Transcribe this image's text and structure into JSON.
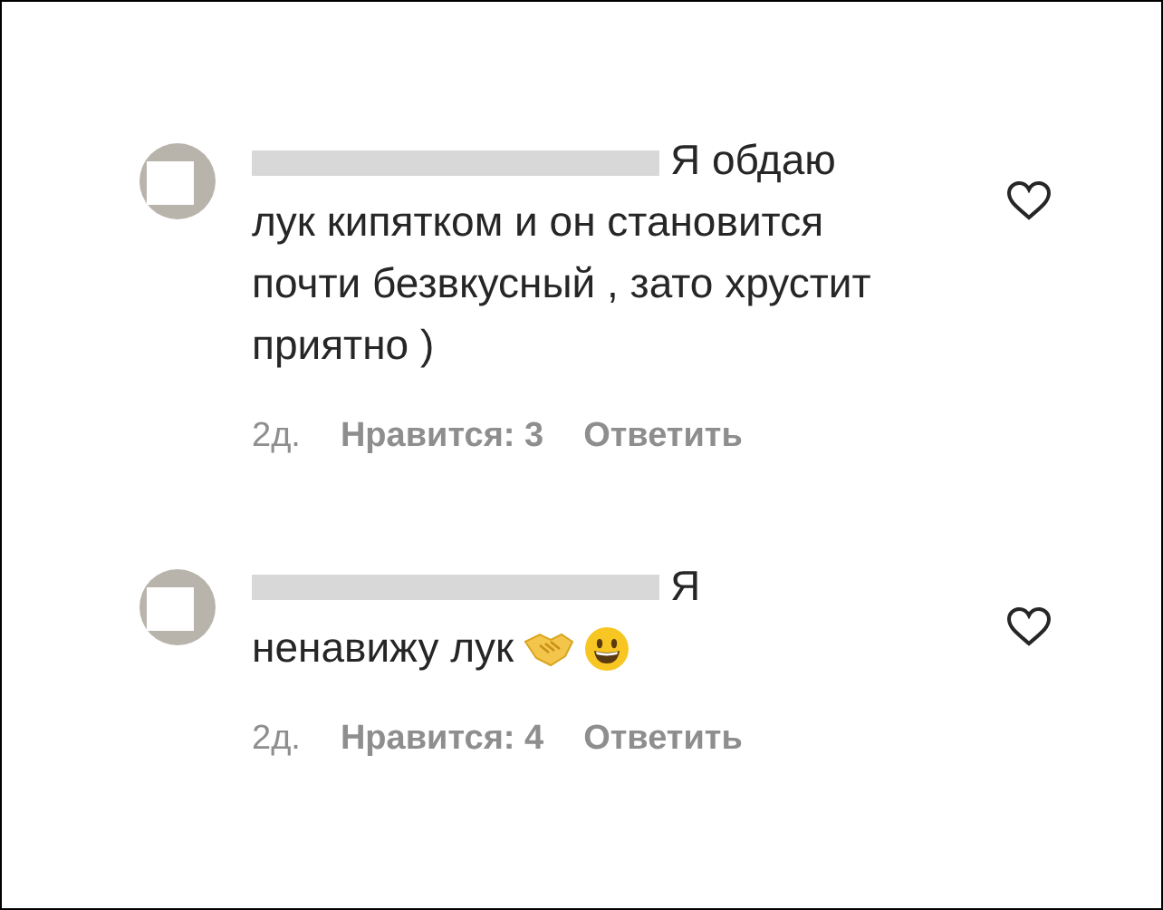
{
  "comments": [
    {
      "text": "Я обдаю лук кипятком и он становится почти безвкусный , зато хрустит приятно )",
      "liked": false,
      "time": "2д.",
      "likes": "Нравится: 3",
      "reply": "Ответить"
    },
    {
      "text": "Я ненавижу лук",
      "emojis": [
        {
          "kind": "handshake"
        },
        {
          "kind": "grin"
        }
      ],
      "liked": false,
      "time": "2д.",
      "likes": "Нравится: 4",
      "reply": "Ответить"
    }
  ]
}
